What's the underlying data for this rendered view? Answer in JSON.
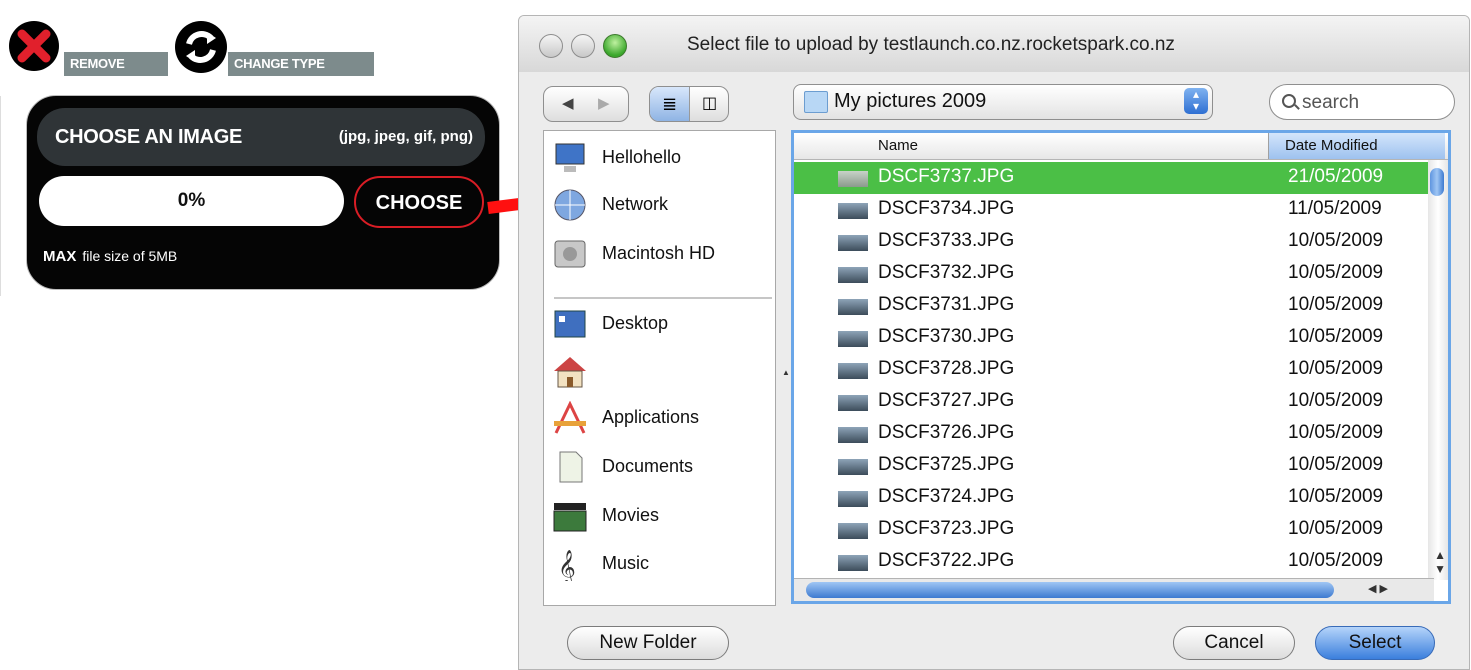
{
  "actions": {
    "remove_label": "REMOVE",
    "change_type_label": "CHANGE TYPE"
  },
  "uploader": {
    "title": "CHOOSE AN IMAGE",
    "types": "(jpg, jpeg, gif, png)",
    "progress_text": "0%",
    "progress_value": 0,
    "choose_label": "CHOOSE",
    "max_label": "MAX",
    "max_text": "file size of 5MB",
    "accent_color": "#d91d25"
  },
  "dialog": {
    "title": "Select file to upload by testlaunch.co.nz.rocketspark.co.nz",
    "location": "My pictures 2009",
    "search_placeholder": "search",
    "sidebar": [
      {
        "label": "Hellohello",
        "icon": "computer-icon"
      },
      {
        "label": "Network",
        "icon": "network-globe-icon"
      },
      {
        "label": "Macintosh HD",
        "icon": "hard-drive-icon"
      },
      {
        "label": "Desktop",
        "icon": "desktop-icon"
      },
      {
        "label": "",
        "icon": "home-icon"
      },
      {
        "label": "Applications",
        "icon": "applications-icon"
      },
      {
        "label": "Documents",
        "icon": "documents-icon"
      },
      {
        "label": "Movies",
        "icon": "movies-icon"
      },
      {
        "label": "Music",
        "icon": "music-icon"
      }
    ],
    "columns": {
      "name": "Name",
      "date": "Date Modified"
    },
    "files": [
      {
        "name": "DSCF3737.JPG",
        "date": "21/05/2009",
        "selected": true
      },
      {
        "name": "DSCF3734.JPG",
        "date": "11/05/2009"
      },
      {
        "name": "DSCF3733.JPG",
        "date": "10/05/2009"
      },
      {
        "name": "DSCF3732.JPG",
        "date": "10/05/2009"
      },
      {
        "name": "DSCF3731.JPG",
        "date": "10/05/2009"
      },
      {
        "name": "DSCF3730.JPG",
        "date": "10/05/2009"
      },
      {
        "name": "DSCF3728.JPG",
        "date": "10/05/2009"
      },
      {
        "name": "DSCF3727.JPG",
        "date": "10/05/2009"
      },
      {
        "name": "DSCF3726.JPG",
        "date": "10/05/2009"
      },
      {
        "name": "DSCF3725.JPG",
        "date": "10/05/2009"
      },
      {
        "name": "DSCF3724.JPG",
        "date": "10/05/2009"
      },
      {
        "name": "DSCF3723.JPG",
        "date": "10/05/2009"
      },
      {
        "name": "DSCF3722.JPG",
        "date": "10/05/2009"
      }
    ],
    "buttons": {
      "new_folder": "New Folder",
      "cancel": "Cancel",
      "select": "Select"
    },
    "selection_color": "#4bbf46"
  }
}
